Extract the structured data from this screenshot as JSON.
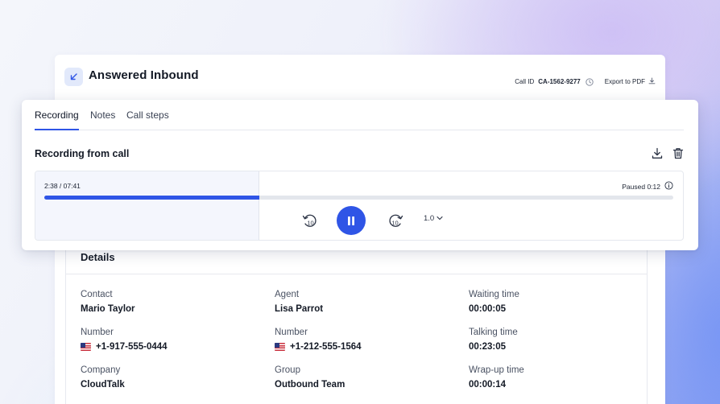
{
  "header": {
    "title": "Answered Inbound",
    "direction_icon": "arrow-down-left-icon",
    "call_id_label": "Call ID",
    "call_id_value": "CA-1562-9277",
    "export_label": "Export to PDF"
  },
  "tabs": [
    {
      "label": "Recording",
      "active": true
    },
    {
      "label": "Notes",
      "active": false
    },
    {
      "label": "Call steps",
      "active": false
    }
  ],
  "recording": {
    "section_title": "Recording from call",
    "time_readout": "2:38 / 07:41",
    "paused_readout": "Paused 0:12",
    "progress_fraction": 0.3425,
    "rewind_label": "10",
    "forward_label": "10",
    "speed": "1.0"
  },
  "details": {
    "title": "Details",
    "fields": [
      {
        "label": "Contact",
        "value": "Mario Taylor"
      },
      {
        "label": "Agent",
        "value": "Lisa Parrot"
      },
      {
        "label": "Waiting time",
        "value": "00:00:05"
      },
      {
        "label": "Number",
        "value": "+1-917-555-0444"
      },
      {
        "label": "Number",
        "value": "+1-212-555-1564"
      },
      {
        "label": "Talking time",
        "value": "00:23:05"
      },
      {
        "label": "Company",
        "value": "CloudTalk"
      },
      {
        "label": "Group",
        "value": "Outbound Team"
      },
      {
        "label": "Wrap-up time",
        "value": "00:00:14"
      }
    ]
  },
  "colors": {
    "accent": "#2f55e6",
    "track": "#e3e6ec"
  }
}
